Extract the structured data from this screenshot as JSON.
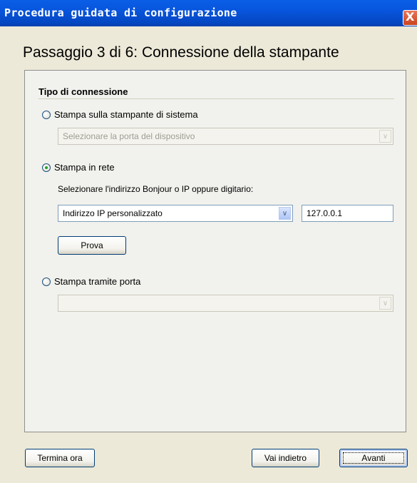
{
  "window": {
    "title": "Procedura guidata di configurazione",
    "close_glyph": "X"
  },
  "step_title": "Passaggio 3 di 6: Connessione della stampante",
  "connection": {
    "group_label": "Tipo di connessione",
    "system_printer": {
      "label": "Stampa sulla stampante di sistema",
      "selected": false,
      "port_placeholder": "Selezionare la porta del dispositivo"
    },
    "network": {
      "label": "Stampa in rete",
      "selected": true,
      "instruction": "Selezionare l'indirizzo Bonjour o IP oppure digitario:",
      "address_type": "Indirizzo IP personalizzato",
      "ip_address": "127.0.0.1",
      "test_button": "Prova"
    },
    "port": {
      "label": "Stampa tramite porta",
      "selected": false,
      "value": ""
    }
  },
  "footer": {
    "finish_now": "Termina ora",
    "back": "Vai indietro",
    "next": "Avanti"
  },
  "colors": {
    "titlebar": "#0855dd",
    "dialog_bg": "#ece9d8",
    "panel_bg": "#f1f1ed",
    "close_button": "#c9431d"
  },
  "icons": {
    "close": "close-icon",
    "dropdown": "chevron-down-icon"
  }
}
